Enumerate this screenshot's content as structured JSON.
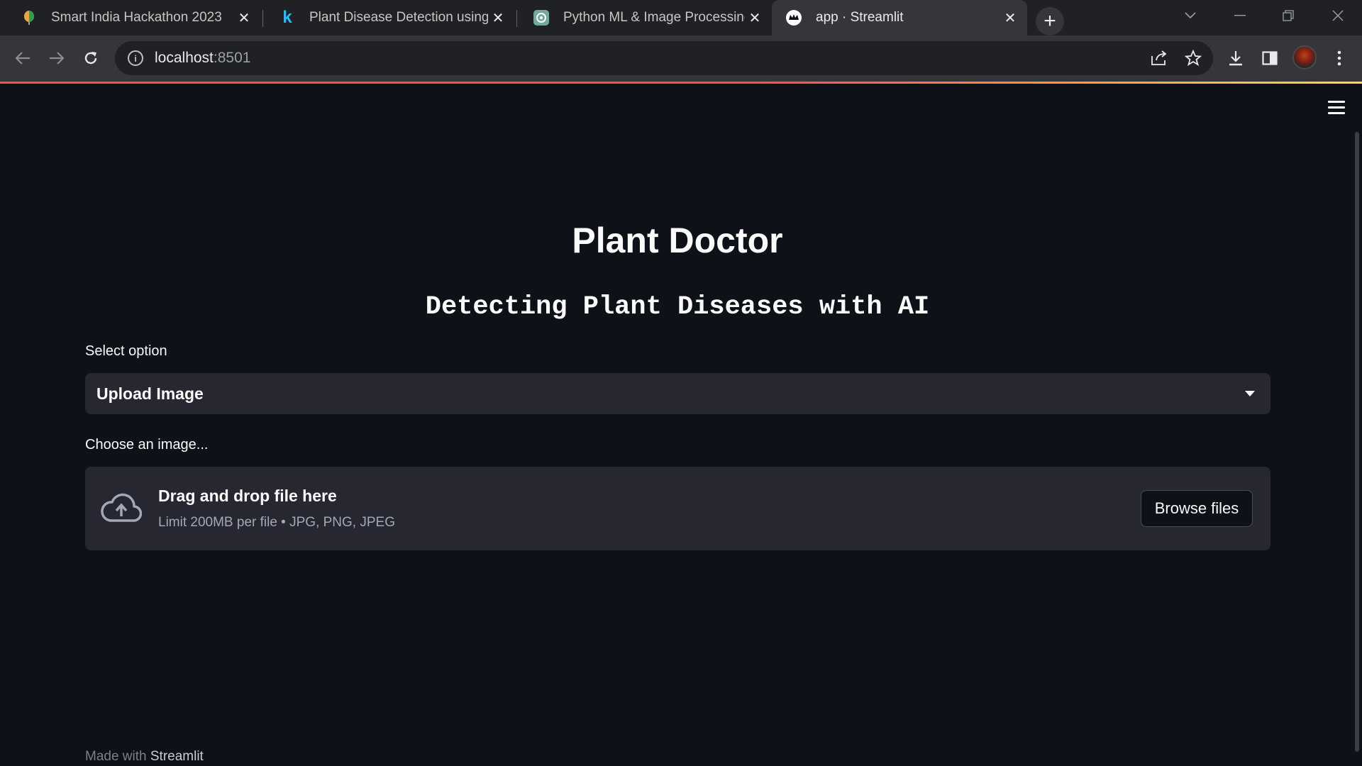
{
  "browser": {
    "tabs": [
      {
        "title": "Smart India Hackathon 2023",
        "favicon": "sih-balloon-icon",
        "active": false
      },
      {
        "title": "Plant Disease Detection using Ke",
        "favicon": "kaggle-k-icon",
        "active": false
      },
      {
        "title": "Python ML & Image Processing",
        "favicon": "openai-icon",
        "active": false
      },
      {
        "title": "app · Streamlit",
        "favicon": "streamlit-crown-icon",
        "active": true
      }
    ],
    "new_tab": "+",
    "url_host": "localhost",
    "url_port": ":8501"
  },
  "app": {
    "title": "Plant Doctor",
    "subtitle": "Detecting Plant Diseases with AI",
    "select": {
      "label": "Select option",
      "value": "Upload Image"
    },
    "uploader": {
      "label": "Choose an image...",
      "title": "Drag and drop file here",
      "hint": "Limit 200MB per file • JPG, PNG, JPEG",
      "button": "Browse files"
    },
    "footer": {
      "prefix": "Made with ",
      "brand": "Streamlit"
    }
  },
  "colors": {
    "background": "#0e1117",
    "widget": "#262730",
    "accent": "#ff4b4b"
  }
}
